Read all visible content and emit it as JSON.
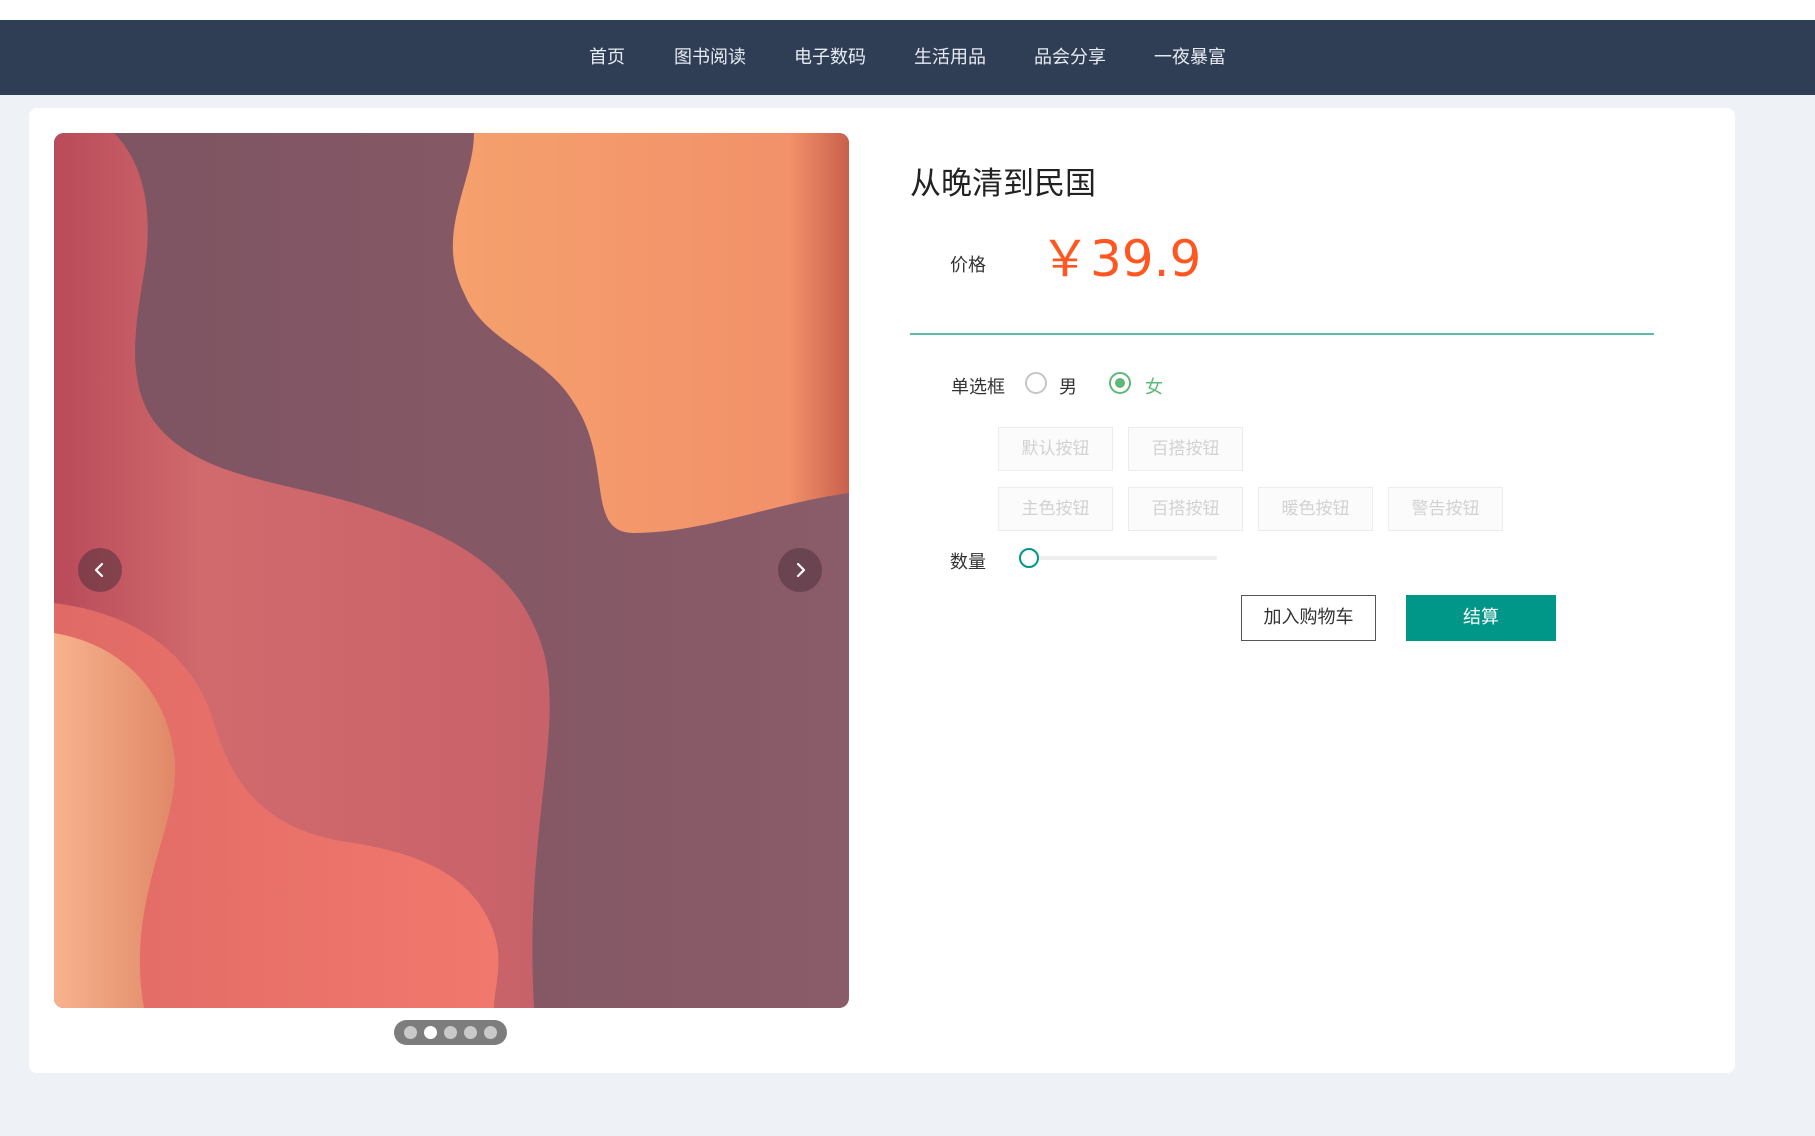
{
  "nav": {
    "items": [
      {
        "label": "首页"
      },
      {
        "label": "图书阅读"
      },
      {
        "label": "电子数码"
      },
      {
        "label": "生活用品"
      },
      {
        "label": "品会分享"
      },
      {
        "label": "一夜暴富"
      }
    ]
  },
  "carousel": {
    "slide_count": 5,
    "active_index": 1,
    "prev_icon": "chevron-left-icon",
    "next_icon": "chevron-right-icon"
  },
  "product": {
    "title": "从晚清到民国",
    "price_label": "价格",
    "price": "￥39.9",
    "price_color": "#ff5722"
  },
  "options": {
    "radio_label": "单选框",
    "radios": [
      {
        "label": "男",
        "checked": false
      },
      {
        "label": "女",
        "checked": true
      }
    ],
    "buttons_row1": [
      "默认按钮",
      "百搭按钮"
    ],
    "buttons_row2": [
      "主色按钮",
      "百搭按钮",
      "暖色按钮",
      "警告按钮"
    ],
    "quantity_label": "数量",
    "quantity_value": 0
  },
  "actions": {
    "add_to_cart": "加入购物车",
    "checkout": "结算",
    "accent": "#009688"
  }
}
